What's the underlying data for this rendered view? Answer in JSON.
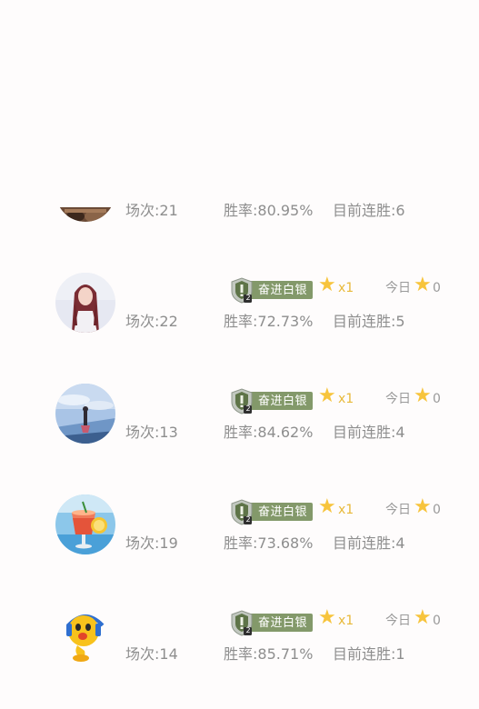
{
  "colors": {
    "background": "#fefcfc",
    "stat_text": "#8e8e8e",
    "badge_fill": "#83996a",
    "star": "#f7c43c",
    "multiplier": "#e8b93a"
  },
  "rows": [
    {
      "avatar_icon": "user-avatar-partial",
      "matches": "场次:21",
      "win_rate": "胜率:80.95%",
      "streak": "目前连胜:6"
    },
    {
      "avatar_icon": "user-avatar-girl-portrait",
      "badge": "奋进白银",
      "badge_tier": "2",
      "multiplier": "x1",
      "today_label": "今日",
      "today_value": "0",
      "matches": "场次:22",
      "win_rate": "胜率:72.73%",
      "streak": "目前连胜:5"
    },
    {
      "avatar_icon": "user-avatar-sky-photo",
      "badge": "奋进白银",
      "badge_tier": "2",
      "multiplier": "x1",
      "today_label": "今日",
      "today_value": "0",
      "matches": "场次:13",
      "win_rate": "胜率:84.62%",
      "streak": "目前连胜:4"
    },
    {
      "avatar_icon": "user-avatar-drink-photo",
      "badge": "奋进白银",
      "badge_tier": "2",
      "multiplier": "x1",
      "today_label": "今日",
      "today_value": "0",
      "matches": "场次:19",
      "win_rate": "胜率:73.68%",
      "streak": "目前连胜:4"
    },
    {
      "avatar_icon": "user-avatar-cartoon-mascot",
      "badge": "奋进白银",
      "badge_tier": "2",
      "multiplier": "x1",
      "today_label": "今日",
      "today_value": "0",
      "matches": "场次:14",
      "win_rate": "胜率:85.71%",
      "streak": "目前连胜:1"
    }
  ]
}
